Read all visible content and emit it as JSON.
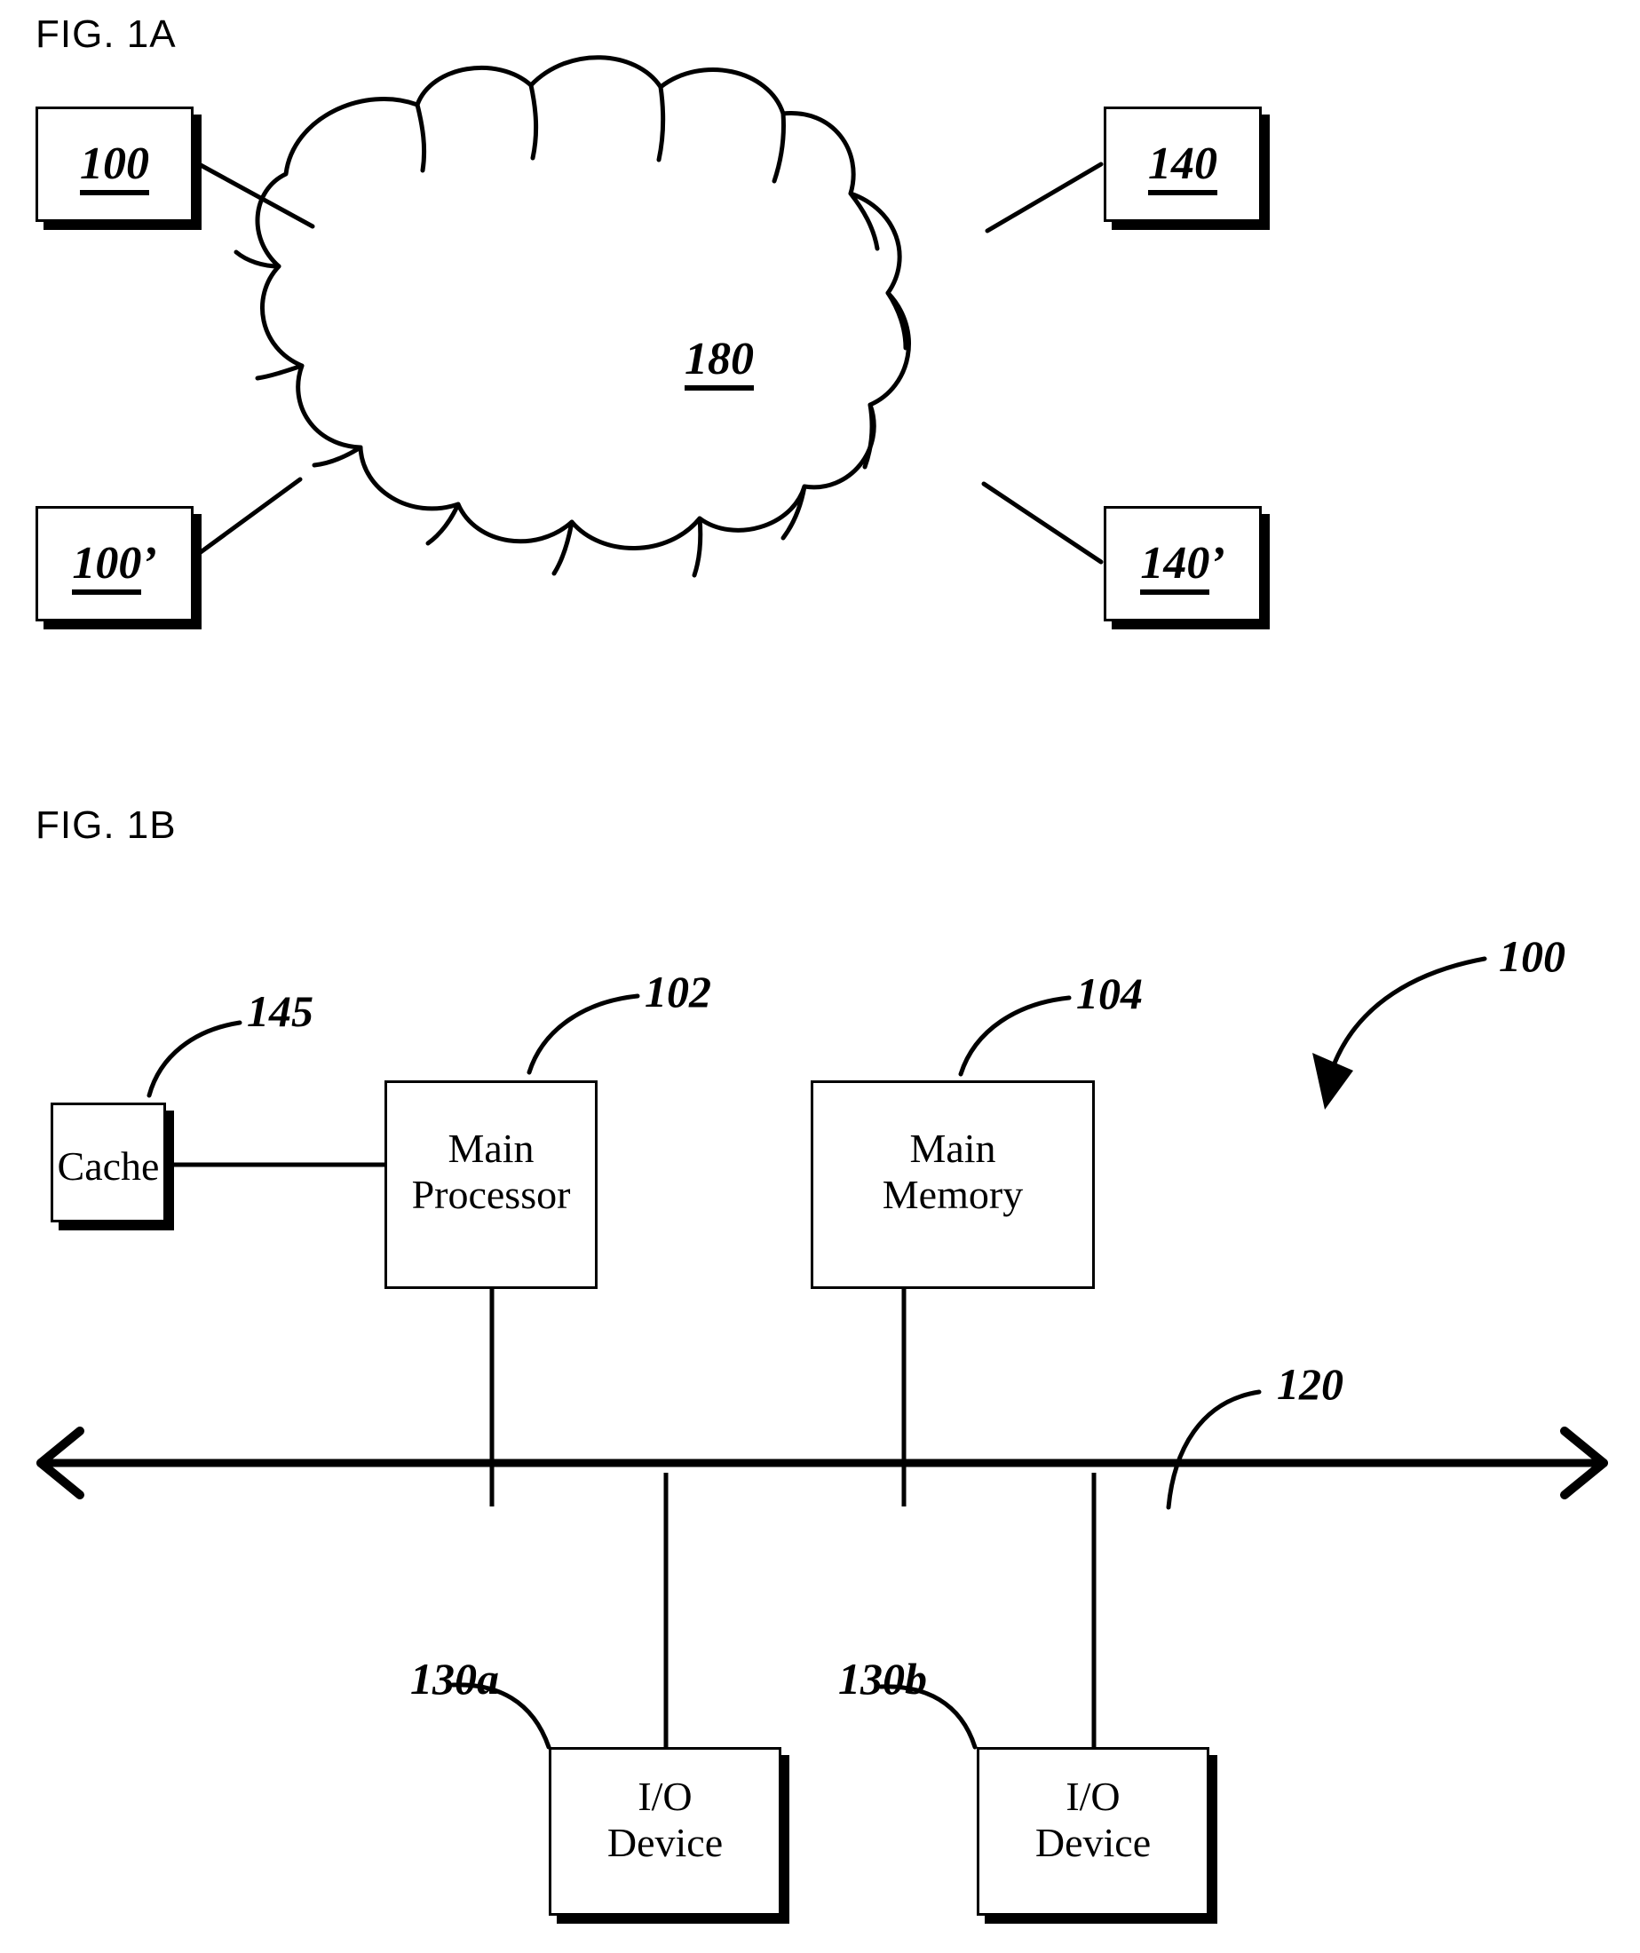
{
  "figures": [
    {
      "id": "fig-1a",
      "label": "FIG. 1A",
      "caption_text": "FIG. 1A",
      "type": "network-cloud-diagram",
      "cloud": {
        "ref": "180",
        "shape": "cloud",
        "semantic": "network"
      },
      "nodes": [
        {
          "ref": "100",
          "position": "top-left",
          "shape": "shadowed-box"
        },
        {
          "ref": "140",
          "position": "top-right",
          "shape": "shadowed-box"
        },
        {
          "ref": "100'",
          "position": "bottom-left",
          "shape": "shadowed-box"
        },
        {
          "ref": "140'",
          "position": "bottom-right",
          "shape": "shadowed-box"
        }
      ],
      "connections": [
        {
          "from": "100",
          "to": "180"
        },
        {
          "from": "140",
          "to": "180"
        },
        {
          "from": "100'",
          "to": "180"
        },
        {
          "from": "140'",
          "to": "180"
        }
      ]
    },
    {
      "id": "fig-1b",
      "label": "FIG. 1B",
      "caption_text": "FIG. 1B",
      "type": "block-architecture-diagram",
      "assembly_ref": "100",
      "blocks": [
        {
          "ref": "145",
          "title_line1": "Cache",
          "title_line2": "",
          "shape": "shadowed-box"
        },
        {
          "ref": "102",
          "title_line1": "Main",
          "title_line2": "Processor",
          "shape": "plain-box"
        },
        {
          "ref": "104",
          "title_line1": "Main",
          "title_line2": "Memory",
          "shape": "plain-box"
        },
        {
          "ref": "130a",
          "title_line1": "I/O",
          "title_line2": "Device",
          "shape": "shadowed-box"
        },
        {
          "ref": "130b",
          "title_line1": "I/O",
          "title_line2": "Device",
          "shape": "shadowed-box"
        }
      ],
      "bus": {
        "ref": "120",
        "style": "double-headed-arrow",
        "semantic": "system-bus"
      },
      "connections": [
        {
          "from": "145",
          "to": "102"
        },
        {
          "from": "102",
          "to": "120"
        },
        {
          "from": "104",
          "to": "120"
        },
        {
          "from": "130a",
          "to": "120"
        },
        {
          "from": "130b",
          "to": "120"
        }
      ]
    }
  ],
  "fig1a": {
    "label": "FIG. 1A",
    "node_tl": "100",
    "node_tr": "140",
    "node_bl_num": "100",
    "node_bl_prime": "’",
    "node_br_num": "140",
    "node_br_prime": "’",
    "cloud_ref": "180"
  },
  "fig1b": {
    "label": "FIG. 1B",
    "assembly_ref": "100",
    "cache_label": "Cache",
    "cache_ref": "145",
    "processor_line1": "Main",
    "processor_line2": "Processor",
    "processor_ref": "102",
    "memory_line1": "Main",
    "memory_line2": "Memory",
    "memory_ref": "104",
    "bus_ref": "120",
    "io_a_line1": "I/O",
    "io_a_line2": "Device",
    "io_a_ref": "130a",
    "io_b_line1": "I/O",
    "io_b_line2": "Device",
    "io_b_ref": "130b"
  },
  "colors": {
    "ink": "#000000",
    "paper": "#ffffff"
  }
}
